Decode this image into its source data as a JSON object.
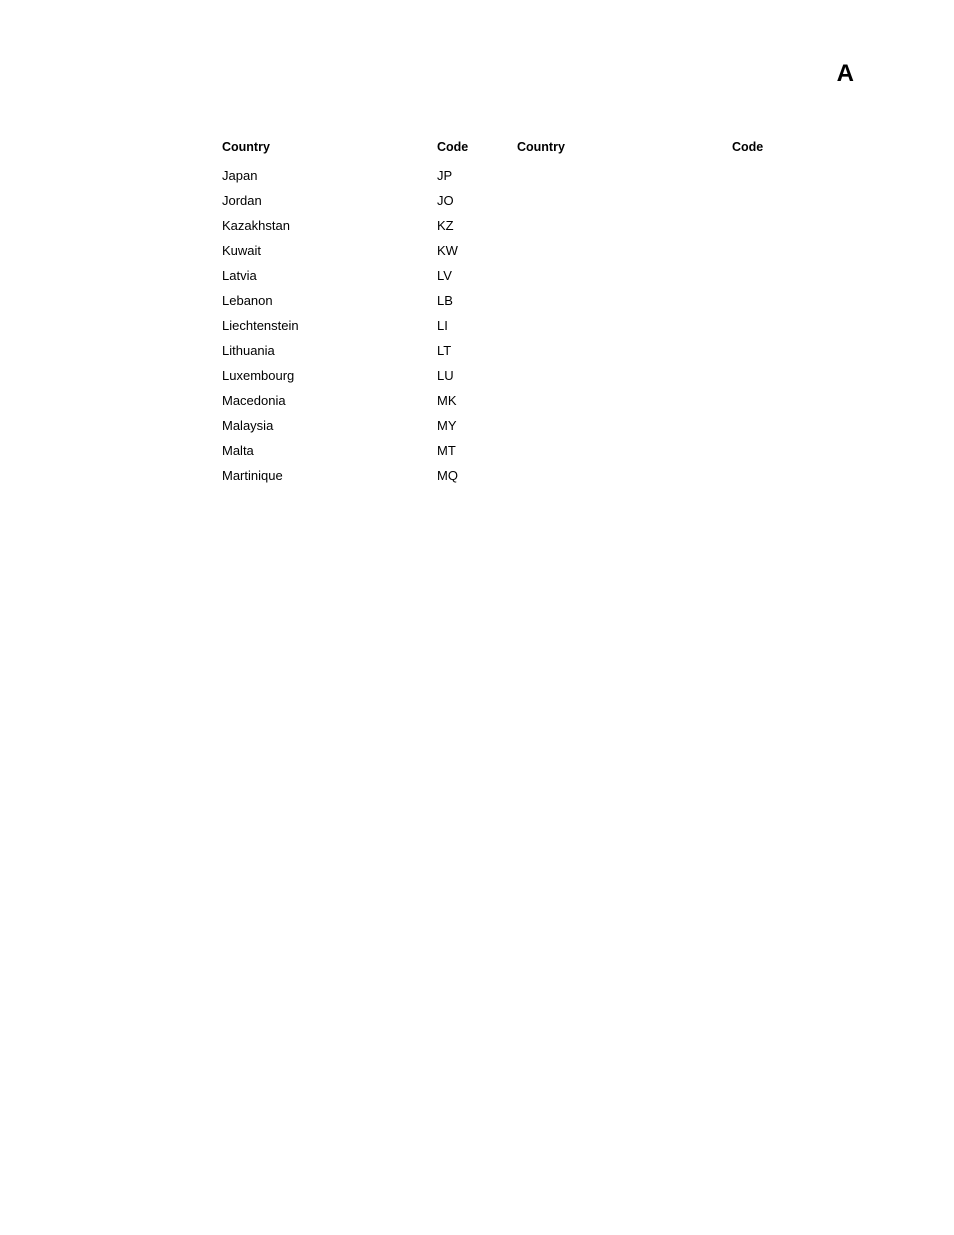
{
  "pageHeader": "A",
  "table": {
    "headers": {
      "country": "Country",
      "code": "Code"
    },
    "leftColumn": [
      {
        "country": "Japan",
        "code": "JP"
      },
      {
        "country": "Jordan",
        "code": "JO"
      },
      {
        "country": "Kazakhstan",
        "code": "KZ"
      },
      {
        "country": "Kuwait",
        "code": "KW"
      },
      {
        "country": "Latvia",
        "code": "LV"
      },
      {
        "country": "Lebanon",
        "code": "LB"
      },
      {
        "country": "Liechtenstein",
        "code": "LI"
      },
      {
        "country": "Lithuania",
        "code": "LT"
      },
      {
        "country": "Luxembourg",
        "code": "LU"
      },
      {
        "country": "Macedonia",
        "code": "MK"
      },
      {
        "country": "Malaysia",
        "code": "MY"
      },
      {
        "country": "Malta",
        "code": "MT"
      },
      {
        "country": "Martinique",
        "code": "MQ"
      }
    ],
    "rightColumn": []
  }
}
